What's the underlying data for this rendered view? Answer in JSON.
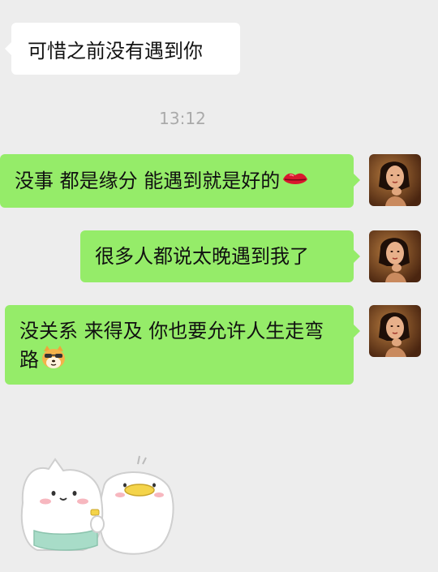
{
  "messages": [
    {
      "side": "incoming",
      "text": "可惜之前没有遇到你"
    },
    {
      "side": "outgoing",
      "text": "没事 都是缘分 能遇到就是好的",
      "emoji": "lips-emoji"
    },
    {
      "side": "outgoing",
      "text": "很多人都说太晚遇到我了"
    },
    {
      "side": "outgoing",
      "text": "没关系 来得及 你也要允许人生走弯路",
      "emoji": "cool-dog-emoji"
    }
  ],
  "timestamp": "13:12",
  "colors": {
    "background": "#ededed",
    "incoming_bubble": "#ffffff",
    "outgoing_bubble": "#95ec69",
    "timestamp_text": "#aaaaaa"
  },
  "sticker": {
    "icon": "cat-duck-hug-sticker"
  }
}
